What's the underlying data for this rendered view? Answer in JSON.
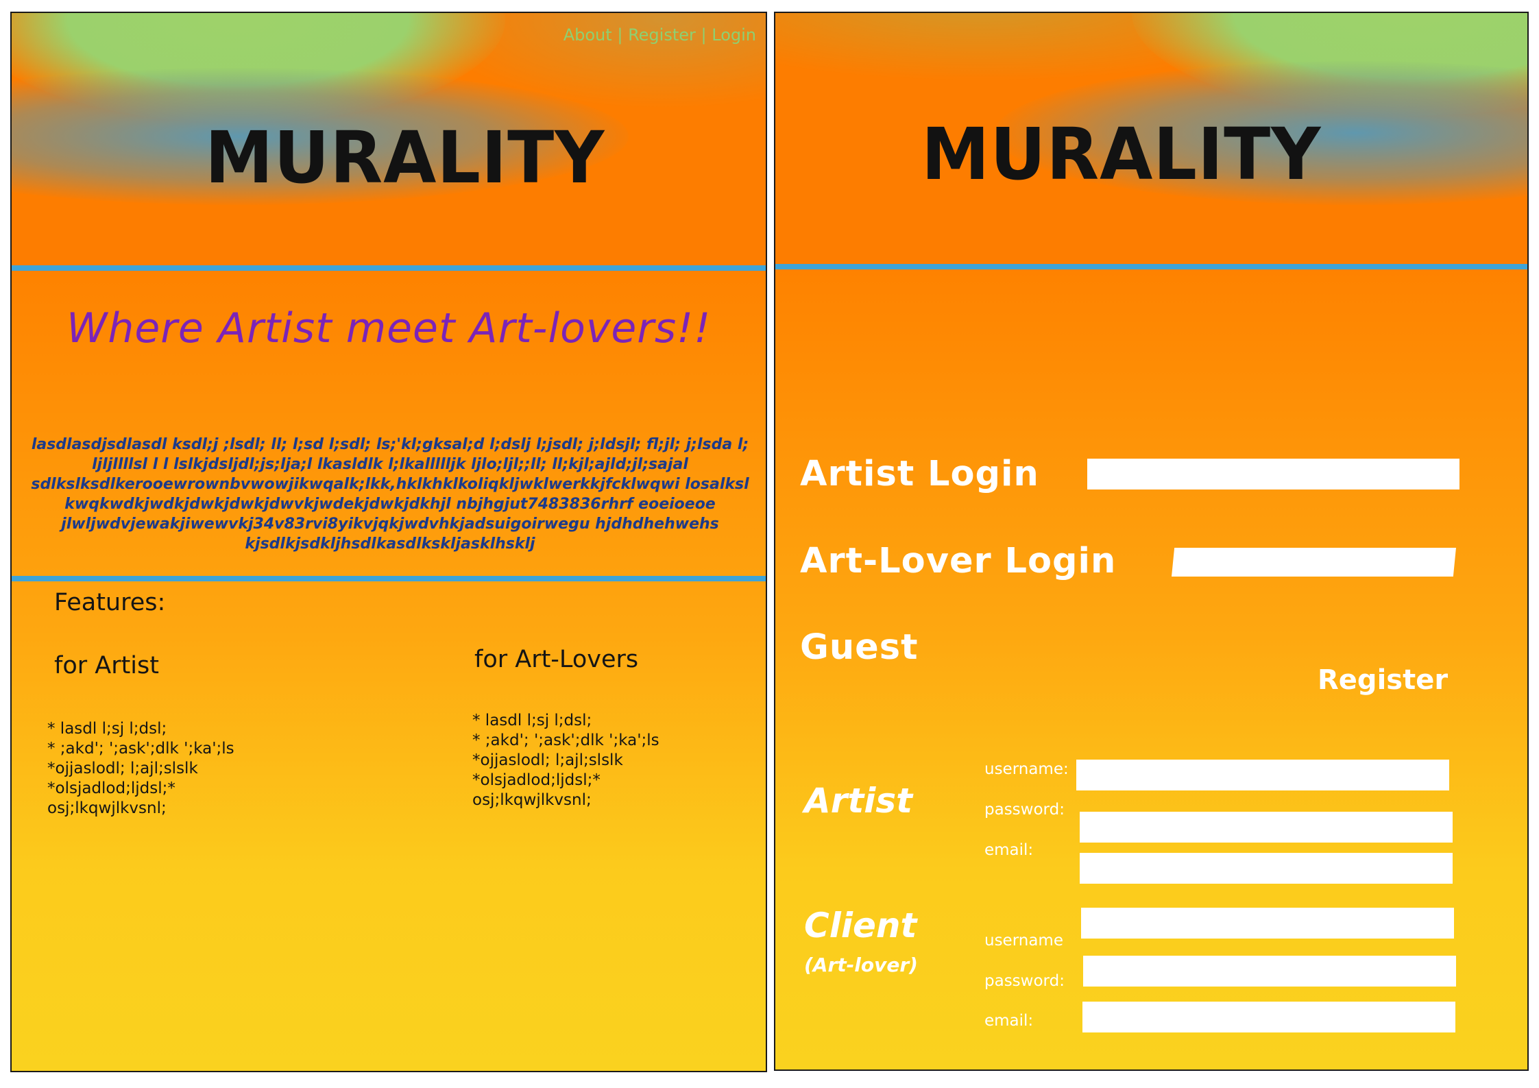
{
  "brand": {
    "logo_text": "MURALITY"
  },
  "home": {
    "nav": {
      "about": "About",
      "register": "Register",
      "login": "Login",
      "separator": "|"
    },
    "tagline": "Where Artist meet Art-lovers!!",
    "blurb_lines": [
      "lasdlasdjsdlasdl ksdl;j ;lsdl; ll; l;sd l;sdl; ls;'kl;gksal;d l;dslj l;jsdl; j;ldsjl; fl;jl; j;lsda l;",
      "ljljllllsl l l  lslkjdsljdl;js;lja;l   lkasldlk l;lkallllljk   ljlo;ljl;;ll;  ll;kjl;ajld;jl;sajal",
      "sdlkslksdlkerooewrownbvwowjikwqalk;lkk,hklkhklkoliqkljwklwerkkjfcklwqwi   losalksl",
      "kwqkwdkjwdkjdwkjdwkjdwvkjwdekjdwkjdkhjl    nbjhgjut7483836rhrf  eoeioeoe",
      "jlwljwdvjewakjiwewvkj34v83rvi8yikvjqkjwdvhkjadsuigoirwegu  hjdhdhehwehs",
      "kjsdlkjsdkljhsdlkasdlkskljasklhsklj"
    ],
    "features": {
      "heading": "Features:",
      "artist": {
        "heading": "for Artist",
        "items": [
          "* lasdl l;sj l;dsl;",
          "* ;akd'; ';ask';dlk ';ka';ls",
          "*ojjaslodl; l;ajl;slslk",
          "*olsjadlod;ljdsl;*",
          "osj;lkqwjlkvsnl;"
        ]
      },
      "art_lovers": {
        "heading": "for Art-Lovers",
        "items": [
          "* lasdl l;sj l;dsl;",
          "* ;akd'; ';ask';dlk ';ka';ls",
          "*ojjaslodl; l;ajl;slslk",
          "*olsjadlod;ljdsl;*",
          "osj;lkqwjlkvsnl;"
        ]
      }
    }
  },
  "login": {
    "artist_login_label": "Artist Login",
    "art_lover_login_label": "Art-Lover Login",
    "guest_label": "Guest",
    "artist_login_value": "",
    "art_lover_login_value": ""
  },
  "register": {
    "heading": "Register",
    "artist": {
      "label": "Artist",
      "username_label": "username:",
      "password_label": "password:",
      "email_label": "email:",
      "username_value": "",
      "password_value": "",
      "email_value": ""
    },
    "client": {
      "label": "Client",
      "sublabel": "(Art-lover)",
      "username_label": "username",
      "password_label": "password:",
      "email_label": "email:",
      "username_value": "",
      "password_value": "",
      "email_value": ""
    }
  },
  "colors": {
    "orange": "#fd7d00",
    "yellow": "#fad21f",
    "green": "#9bd16c",
    "blue_bar": "#3ea4d8",
    "tagline_purple": "#7b24b8",
    "blurb_blue": "#1c3a8a",
    "nav_green": "#8ed071"
  }
}
